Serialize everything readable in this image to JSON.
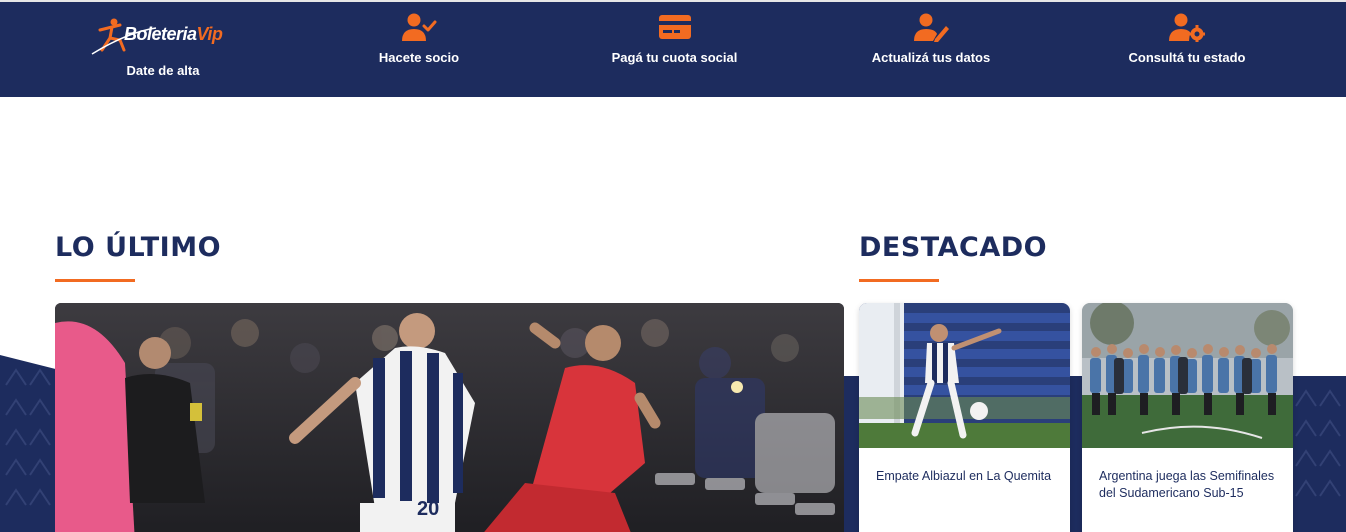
{
  "nav": {
    "brand": {
      "logo_text_main": "Boleteria",
      "logo_text_accent": "Vip",
      "label": "Date de alta"
    },
    "items": [
      {
        "label": "Hacete socio",
        "icon": "user-check-icon"
      },
      {
        "label": "Pagá tu cuota social",
        "icon": "credit-card-icon"
      },
      {
        "label": "Actualizá tus datos",
        "icon": "user-edit-icon"
      },
      {
        "label": "Consultá tu estado",
        "icon": "user-gear-icon"
      }
    ]
  },
  "latest": {
    "title": "LO ÚLTIMO"
  },
  "featured": {
    "title": "DESTACADO",
    "cards": [
      {
        "caption": "Empate Albiazul en La Quemita"
      },
      {
        "caption": "Argentina juega las Semifinales del Sudamericano Sub-15"
      }
    ]
  },
  "colors": {
    "navy": "#1d2c5e",
    "accent": "#f26b21"
  }
}
